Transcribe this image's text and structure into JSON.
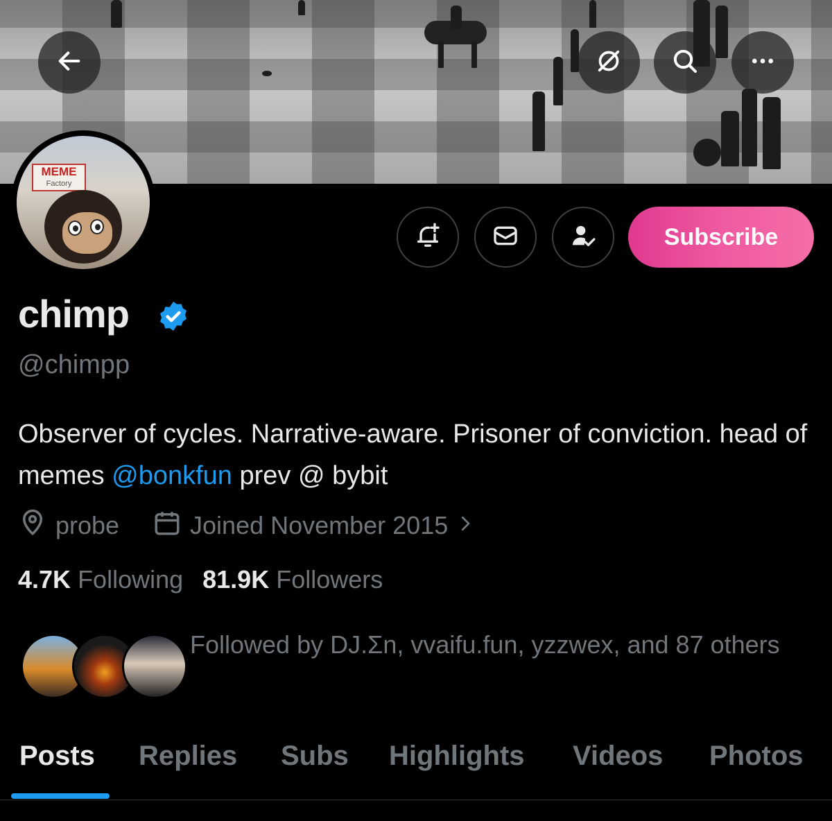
{
  "profile": {
    "name": "chimp",
    "handle": "@chimpp",
    "bio_prefix": "Observer of cycles. Narrative-aware. Prisoner of conviction. head of memes ",
    "bio_mention": "@bonkfun",
    "bio_suffix": " prev @ bybit",
    "location": "probe",
    "joined": "Joined November 2015",
    "following_count": "4.7K",
    "following_label": "Following",
    "followers_count": "81.9K",
    "followers_label": "Followers",
    "followed_by": "Followed by DJ.Σn, vvaifu.fun, yzzwex, and 87 others",
    "avatar_sign_text": "MEME",
    "avatar_sign_subtext": "Factory"
  },
  "actions": {
    "subscribe_label": "Subscribe"
  },
  "icons": {
    "back": "arrow-left-icon",
    "grok": "grok-icon",
    "search": "search-icon",
    "more": "more-icon",
    "notify": "bell-plus-icon",
    "message": "envelope-icon",
    "follow_status": "person-check-icon",
    "location": "location-pin-icon",
    "calendar": "calendar-icon",
    "chevron": "chevron-right-icon",
    "verified": "verified-badge-icon"
  },
  "tabs": [
    {
      "label": "Posts"
    },
    {
      "label": "Replies"
    },
    {
      "label": "Subs"
    },
    {
      "label": "Highlights"
    },
    {
      "label": "Videos"
    },
    {
      "label": "Photos"
    }
  ],
  "colors": {
    "accent": "#1d9bf0",
    "subscribe": "#ec4f9c",
    "muted": "#71767b",
    "text": "#e7e9ea"
  }
}
